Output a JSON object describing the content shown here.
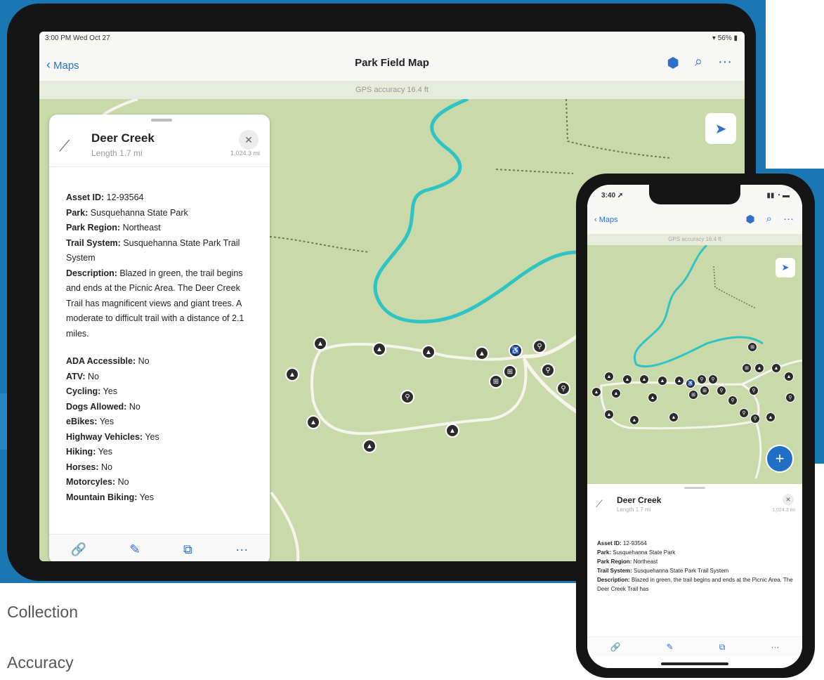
{
  "ipad": {
    "status_time": "3:00 PM  Wed Oct 27",
    "status_battery": "▾ 56% ▮",
    "back_label": "Maps",
    "title": "Park Field Map",
    "gps_accuracy": "GPS accuracy 16.4 ft",
    "icons": {
      "layers": "⬢",
      "search": "⌕",
      "more": "···",
      "locate": "➤"
    },
    "card": {
      "title": "Deer Creek",
      "subtitle": "Length 1.7 mi",
      "distance": "1,024.3 mi",
      "fields": [
        {
          "label": "Asset ID:",
          "value": " 12-93564"
        },
        {
          "label": "Park:",
          "value": " Susquehanna State Park"
        },
        {
          "label": "Park Region:",
          "value": " Northeast"
        },
        {
          "label": "Trail System:",
          "value": " Susquehanna State Park Trail System"
        },
        {
          "label": "Description:",
          "value": " Blazed in green, the trail begins and ends at the Picnic Area. The Deer Creek Trail has magnificent views and giant trees. A moderate to difficult trail with a distance of 2.1 miles."
        }
      ],
      "attributes": [
        {
          "label": "ADA Accessible:",
          "value": " No"
        },
        {
          "label": "ATV:",
          "value": " No"
        },
        {
          "label": "Cycling:",
          "value": " Yes"
        },
        {
          "label": "Dogs Allowed:",
          "value": " No"
        },
        {
          "label": "eBikes:",
          "value": " Yes"
        },
        {
          "label": "Highway Vehicles:",
          "value": " Yes"
        },
        {
          "label": "Hiking:",
          "value": " Yes"
        },
        {
          "label": "Horses:",
          "value": " No"
        },
        {
          "label": "Motorcyles:",
          "value": " No"
        },
        {
          "label": "Mountain Biking:",
          "value": " Yes"
        }
      ],
      "toolbar": {
        "attach": "🔗",
        "edit": "✎",
        "copy": "⧉",
        "more": "···"
      }
    }
  },
  "phone": {
    "status_time": "3:40 ➚",
    "status_battery": "▮▮ ◔ ▬",
    "back_label": "Maps",
    "gps_accuracy": "GPS accuracy 16.4 ft",
    "card": {
      "title": "Deer Creek",
      "subtitle": "Length 1.7 mi",
      "distance": "1,024.3 mi",
      "fields": [
        {
          "label": "Asset ID:",
          "value": " 12-93564"
        },
        {
          "label": "Park:",
          "value": " Susquehanna State Park"
        },
        {
          "label": "Park Region:",
          "value": " Northeast"
        },
        {
          "label": "Trail System:",
          "value": " Susquehanna State Park Trail System"
        },
        {
          "label": "Description:",
          "value": " Blazed in green, the trail begins and ends at the Picnic Area. The Deer Creek Trail has"
        }
      ]
    },
    "fab": "+"
  },
  "captions": {
    "collection": "Collection",
    "accuracy": "Accuracy"
  },
  "colors": {
    "map_bg": "#cad9a9",
    "river": "#2fc4c4",
    "trail": "#f5f5ee",
    "accent": "#2f6fc9",
    "frame_bg": "#1b77b3"
  }
}
